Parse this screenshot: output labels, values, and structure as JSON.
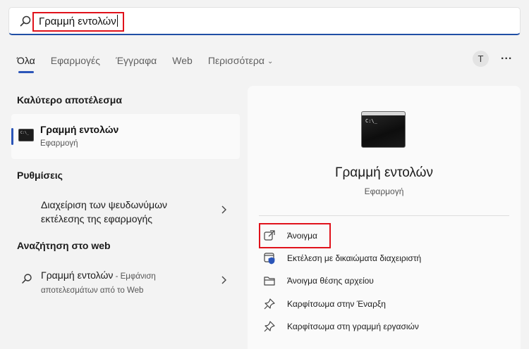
{
  "search": {
    "query": "Γραμμή εντολών"
  },
  "tabs": [
    {
      "label": "Όλα",
      "active": true
    },
    {
      "label": "Εφαρμογές"
    },
    {
      "label": "Έγγραφα"
    },
    {
      "label": "Web"
    },
    {
      "label": "Περισσότερα"
    }
  ],
  "header": {
    "avatar_letter": "T",
    "more_label": "..."
  },
  "best_match": {
    "heading": "Καλύτερο αποτέλεσμα",
    "name": "Γραμμή εντολών",
    "type": "Εφαρμογή"
  },
  "settings": {
    "heading": "Ρυθμίσεις",
    "item_line1": "Διαχείριση των ψευδωνύμων",
    "item_line2": "εκτέλεσης της εφαρμογής"
  },
  "web_search": {
    "heading": "Αναζήτηση στο web",
    "query": "Γραμμή εντολών",
    "suffix": " - Εμφάνιση",
    "sub": "αποτελεσμάτων από το Web"
  },
  "detail": {
    "title": "Γραμμή εντολών",
    "type": "Εφαρμογή",
    "prompt": "C:\\_",
    "actions": [
      {
        "label": "Άνοιγμα",
        "icon": "open-external-icon"
      },
      {
        "label": "Εκτέλεση με δικαιώματα διαχειριστή",
        "icon": "admin-shield-icon"
      },
      {
        "label": "Άνοιγμα θέσης αρχείου",
        "icon": "folder-icon"
      },
      {
        "label": "Καρφίτσωμα στην Έναρξη",
        "icon": "pin-icon"
      },
      {
        "label": "Καρφίτσωμα στη γραμμή εργασιών",
        "icon": "pin-icon"
      }
    ]
  },
  "colors": {
    "accent": "#2b55b8",
    "highlight_box": "#e0121b"
  }
}
